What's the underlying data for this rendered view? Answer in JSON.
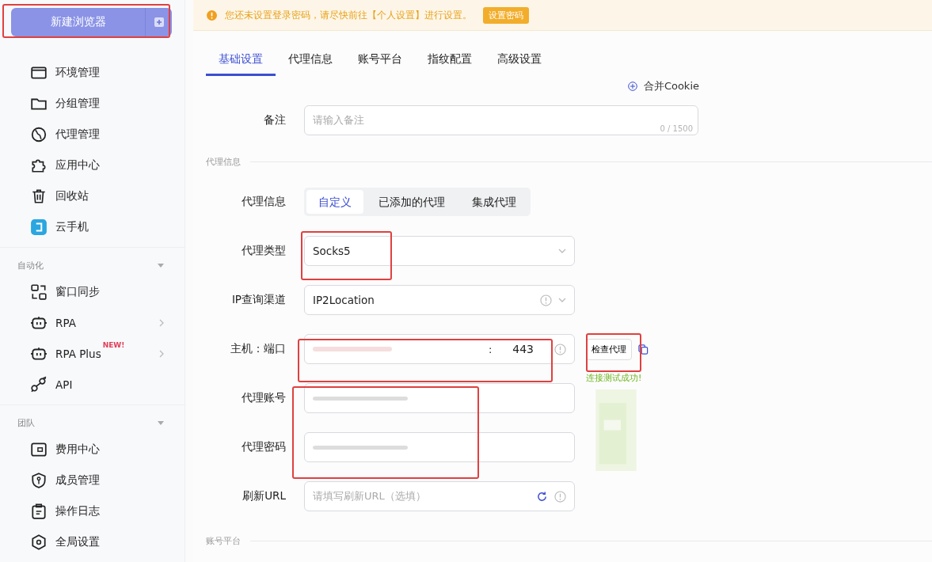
{
  "notice": {
    "text": "您还未设置登录密码，请尽快前往【个人设置】进行设置。",
    "button": "设置密码"
  },
  "sidebar": {
    "new_button": "新建浏览器",
    "items": [
      {
        "label": "环境管理"
      },
      {
        "label": "分组管理"
      },
      {
        "label": "代理管理"
      },
      {
        "label": "应用中心"
      },
      {
        "label": "回收站"
      },
      {
        "label": "云手机"
      }
    ],
    "groups": [
      {
        "title": "自动化",
        "expanded": true,
        "items": [
          {
            "label": "窗口同步",
            "submenu": false
          },
          {
            "label": "RPA",
            "submenu": true
          },
          {
            "label": "RPA Plus",
            "submenu": true,
            "badge": "NEW!"
          },
          {
            "label": "API",
            "submenu": false
          }
        ]
      },
      {
        "title": "团队",
        "expanded": true,
        "items": [
          {
            "label": "费用中心",
            "submenu": false
          },
          {
            "label": "成员管理",
            "submenu": false
          },
          {
            "label": "操作日志",
            "submenu": false
          },
          {
            "label": "全局设置",
            "submenu": false
          }
        ]
      }
    ]
  },
  "tabs": [
    {
      "label": "基础设置",
      "selected": true
    },
    {
      "label": "代理信息",
      "selected": false
    },
    {
      "label": "账号平台",
      "selected": false
    },
    {
      "label": "指纹配置",
      "selected": false
    },
    {
      "label": "高级设置",
      "selected": false
    }
  ],
  "merge_cookie": "合并Cookie",
  "remark": {
    "label": "备注",
    "placeholder": "请输入备注",
    "counter": "0 / 1500"
  },
  "proxy_section": "代理信息",
  "proxy_rows": [
    {
      "kind": "segmented",
      "label": "代理信息",
      "options": [
        {
          "label": "自定义",
          "selected": true
        },
        {
          "label": "已添加的代理",
          "selected": false
        },
        {
          "label": "集成代理",
          "selected": false
        }
      ]
    },
    {
      "kind": "select",
      "label": "代理类型",
      "value": "Socks5",
      "info": false
    },
    {
      "kind": "select",
      "label": "IP查询渠道",
      "value": "IP2Location",
      "info": true
    },
    {
      "kind": "host_port",
      "label": "主机：端口",
      "separator": ":",
      "port": "443",
      "check_button": "检查代理",
      "result": "连接测试成功!"
    },
    {
      "kind": "masked",
      "label": "代理账号"
    },
    {
      "kind": "masked",
      "label": "代理密码"
    },
    {
      "kind": "input",
      "label": "刷新URL",
      "placeholder": "请填写刷新URL（选填）"
    }
  ],
  "next_section": "账号平台"
}
